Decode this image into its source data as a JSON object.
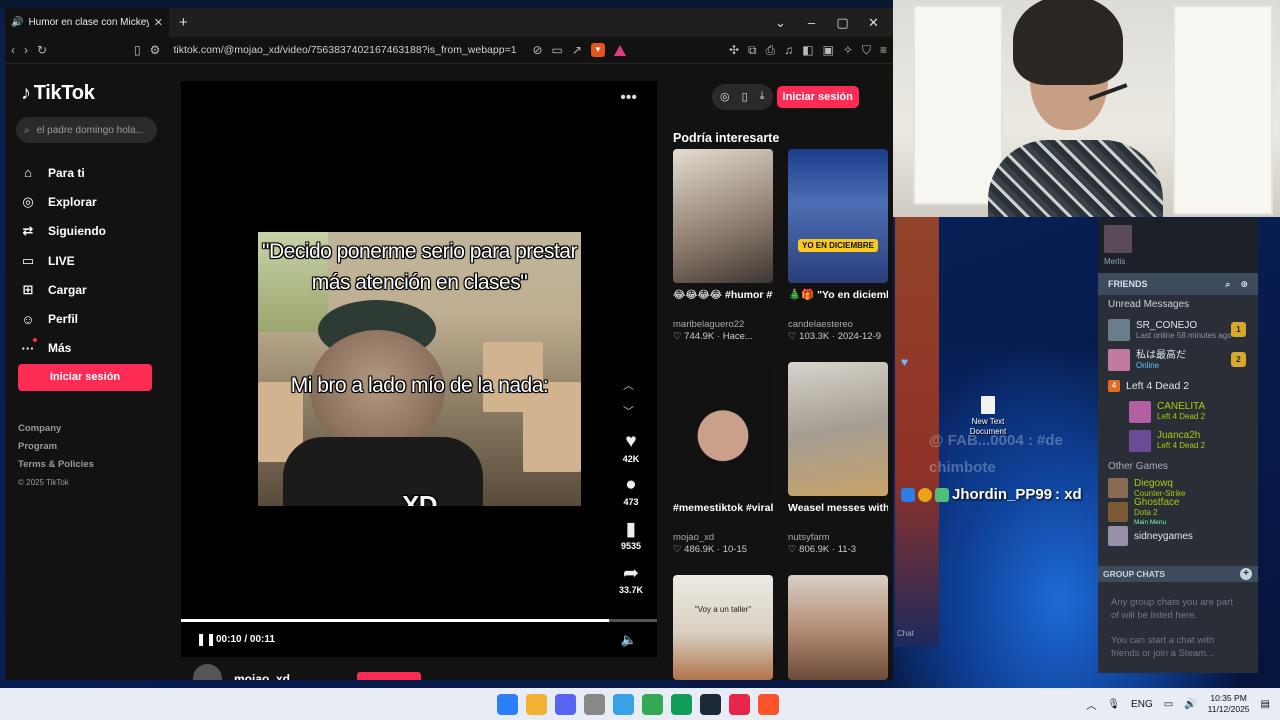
{
  "browser": {
    "tab_title": "Humor en clase con Mickey M",
    "url": "tiktok.com/@mojao_xd/video/7563837402167463188?is_from_webapp=1"
  },
  "sidebar": {
    "logo": "TikTok",
    "search_placeholder": "el padre domingo hola...",
    "nav": [
      "Para ti",
      "Explorar",
      "Siguiendo",
      "LIVE",
      "Cargar",
      "Perfil",
      "Más"
    ],
    "login": "Iniciar sesión",
    "footer": [
      "Company",
      "Program",
      "Terms & Policies"
    ],
    "copyright": "© 2025 TikTok"
  },
  "video": {
    "caption_top": "\"Decido ponerme serio para prestar más atención en clases\"",
    "caption_mid": "Mi bro a lado mío de la nada:",
    "caption_xd": "XD",
    "likes": "42K",
    "comments": "473",
    "saves": "9535",
    "shares": "33.7K",
    "time": "00:10 / 00:11",
    "progress": 0.9,
    "author": "mojao_xd"
  },
  "header": {
    "login": "Iniciar sesión"
  },
  "recs": {
    "title": "Podría interesarte",
    "cards": [
      {
        "desc": "😂😂😂😂 #humor #fypシ #parati #ris...",
        "author": "maribelaguero22",
        "meta": "♡ 744.9K · Hace...",
        "overlay": ""
      },
      {
        "desc": "🎄🎁 \"Yo en diciembre: humilde...",
        "author": "candelaestereo",
        "meta": "♡ 103.3K · 2024-12-9",
        "overlay": "YO EN DICIEMBRE"
      },
      {
        "desc": "#memestiktok #viraldiktiktok...",
        "author": "mojao_xd",
        "meta": "♡ 486.9K · 10-15",
        "overlay": ""
      },
      {
        "desc": "Weasel messes with \"chicken\"—it's a ca...",
        "author": "nutsyfarm",
        "meta": "♡ 806.9K · 11-3",
        "overlay": ""
      },
      {
        "desc": "",
        "author": "",
        "meta": "",
        "overlay": "\"Voy a un taller\""
      },
      {
        "desc": "",
        "author": "",
        "meta": "",
        "overlay": ""
      }
    ]
  },
  "stream": {
    "chat_user": "Jhordin_PP99",
    "chat_msg": ": xd",
    "faint_1": "@ FAB...0004 : #de",
    "faint_2": "chimbote",
    "desk_icon": "New Text Document",
    "chat_label": "Chat"
  },
  "steam": {
    "user": "Merlis",
    "friends": "FRIENDS",
    "unread": "Unread Messages",
    "unread_list": [
      {
        "name": "SR_CONEJO",
        "status": "Last online 58 minutes ago",
        "count": "1"
      },
      {
        "name": "私は最高だ",
        "status": "Online",
        "count": "2"
      }
    ],
    "game_group": "Left 4 Dead 2",
    "game_players": [
      {
        "name": "CANELITA",
        "game": "Left 4 Dead 2"
      },
      {
        "name": "Juanca2h",
        "game": "Left 4 Dead 2"
      }
    ],
    "other_games": "Other Games",
    "others": [
      {
        "name": "Diegowq",
        "game": "Counter-Strike"
      },
      {
        "name": "Ghostface",
        "game": "Dota 2",
        "sub": "Main Menu"
      },
      {
        "name": "sidneygames",
        "game": ""
      }
    ],
    "group_chats": "GROUP CHATS",
    "group_text": "Any group chats you are part of will be listed here.",
    "group_text2": "You can start a chat with friends or join a Steam..."
  },
  "taskbar": {
    "lang": "ENG",
    "time": "10:35 PM",
    "date": "11/12/2025",
    "icon_colors": [
      "#2d7ff9",
      "#f2b233",
      "#5865f2",
      "#888888",
      "#3aa0e8",
      "#34a853",
      "#0f9d58",
      "#1b2838",
      "#e8254a",
      "#fb542b"
    ]
  },
  "colors": {
    "tiktok_red": "#fe2c55",
    "steam_bg": "#2a2e36"
  }
}
